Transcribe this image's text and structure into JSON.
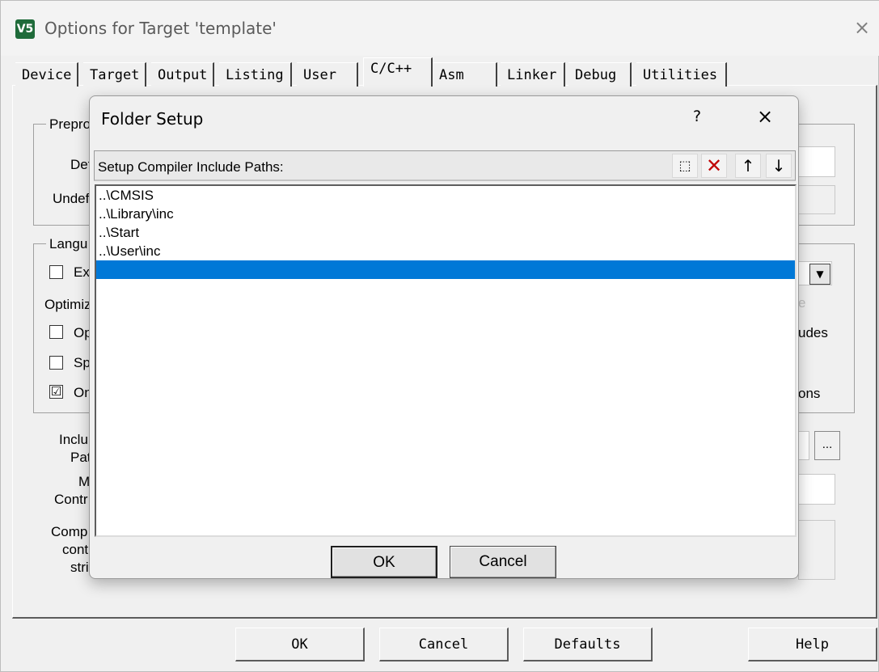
{
  "window": {
    "title": "Options for Target 'template'",
    "icon_text": "V5",
    "close_glyph": "×"
  },
  "tabs": [
    {
      "label": "Device"
    },
    {
      "label": "Target"
    },
    {
      "label": "Output"
    },
    {
      "label": "Listing"
    },
    {
      "label": "User"
    },
    {
      "label": "C/C++",
      "active": true
    },
    {
      "label": "Asm"
    },
    {
      "label": "Linker"
    },
    {
      "label": "Debug"
    },
    {
      "label": "Utilities"
    }
  ],
  "background_panel": {
    "preprocessor_group": "Prepro",
    "define_label": "Def",
    "undefine_label": "Undef",
    "language_group": "Langu",
    "check_ex": "Ex",
    "optimization_label": "Optimiz",
    "check_op": "Op",
    "check_sp": "Sp",
    "check_on": "On",
    "check_on_state": "☑",
    "right_e": "e",
    "right_udes": "udes",
    "right_ons": "ons",
    "include_label_1": "Inclu",
    "include_label_2": "Pat",
    "misc_label_1": "M",
    "misc_label_2": "Contr",
    "compiler_label_1": "Comp",
    "compiler_label_2": "cont",
    "compiler_label_3": "stri",
    "browse_label": "...",
    "dropdown_glyph": "▼"
  },
  "folder_setup": {
    "title": "Folder Setup",
    "help_glyph": "?",
    "close_glyph": "×",
    "list_header": "Setup Compiler Include Paths:",
    "toolbar": {
      "new_icon": "new-folder-icon",
      "delete_icon": "delete-icon",
      "up_icon": "move-up-icon",
      "down_icon": "move-down-icon",
      "new_glyph": "⬚",
      "delete_glyph": "✕",
      "up_glyph": "↑",
      "down_glyph": "↓"
    },
    "paths": [
      "..\\CMSIS",
      "..\\Library\\inc",
      "..\\Start",
      "..\\User\\inc",
      ""
    ],
    "selected_index": 4,
    "ok_label": "OK",
    "cancel_label": "Cancel"
  },
  "bottom_buttons": {
    "ok": "OK",
    "cancel": "Cancel",
    "defaults": "Defaults",
    "help": "Help"
  },
  "colors": {
    "selection": "#0078d7",
    "delete_red": "#c00000",
    "app_icon_green": "#1f6b3a"
  }
}
